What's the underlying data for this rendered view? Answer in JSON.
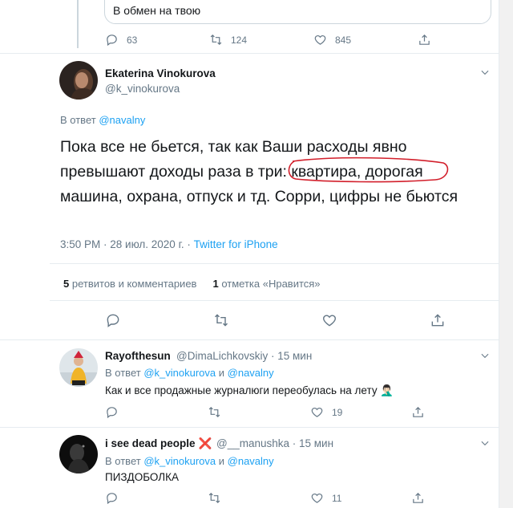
{
  "quoted": {
    "text": "В обмен на твою",
    "actions": {
      "replies": "63",
      "retweets": "124",
      "likes": "845"
    }
  },
  "tweet": {
    "author_name": "Ekaterina Vinokurova",
    "author_handle": "@k_vinokurova",
    "reply_prefix": "В ответ",
    "reply_to": "@navalny",
    "text_before": "Пока все не бьется, так как Ваши расходы явно превышают доходы раза в три:",
    "text_circled": "квартира, дорогая",
    "text_after": "машина, охрана, отпуск и тд. Сорри, цифры не бьются",
    "time": "3:50 PM · 28 июл. 2020 г. · ",
    "source": "Twitter for iPhone",
    "retweets_count": "5",
    "retweets_label": "ретвитов и комментариев",
    "likes_count": "1",
    "likes_label": "отметка «Нравится»"
  },
  "replies": [
    {
      "name": "Rayofthesun",
      "handle": "@DimaLichkovskiy · 15 мин",
      "reply_prefix": "В ответ",
      "mention1": "@k_vinokurova",
      "joiner": "и",
      "mention2": "@navalny",
      "text": "Как и все продажные журналюги переобулась на лету 🤦🏻‍♂️",
      "replies": "",
      "retweets": "",
      "likes": "19"
    },
    {
      "name": "i see dead people",
      "emoji": "❌",
      "handle": "@__manushka · 15 мин",
      "reply_prefix": "В ответ",
      "mention1": "@k_vinokurova",
      "joiner": "и",
      "mention2": "@navalny",
      "text": "ПИЗДОБОЛКА",
      "replies": "",
      "retweets": "",
      "likes": "11"
    }
  ],
  "colors": {
    "link": "#1da1f2",
    "muted": "#657786",
    "circle": "#d21f2b"
  },
  "icons": [
    "reply-icon",
    "retweet-icon",
    "like-icon",
    "share-icon",
    "chevron-down-icon"
  ]
}
